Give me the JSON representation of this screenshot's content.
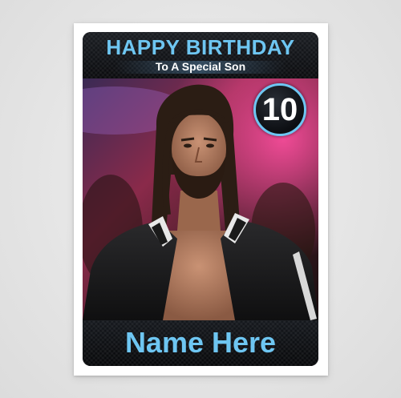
{
  "card": {
    "title": "HAPPY BIRTHDAY",
    "subtitle": "To A Special Son",
    "age": "10",
    "name": "Name Here",
    "accent_color": "#6ec6f2",
    "photo_description_icon": "wrestler-portrait-image"
  }
}
